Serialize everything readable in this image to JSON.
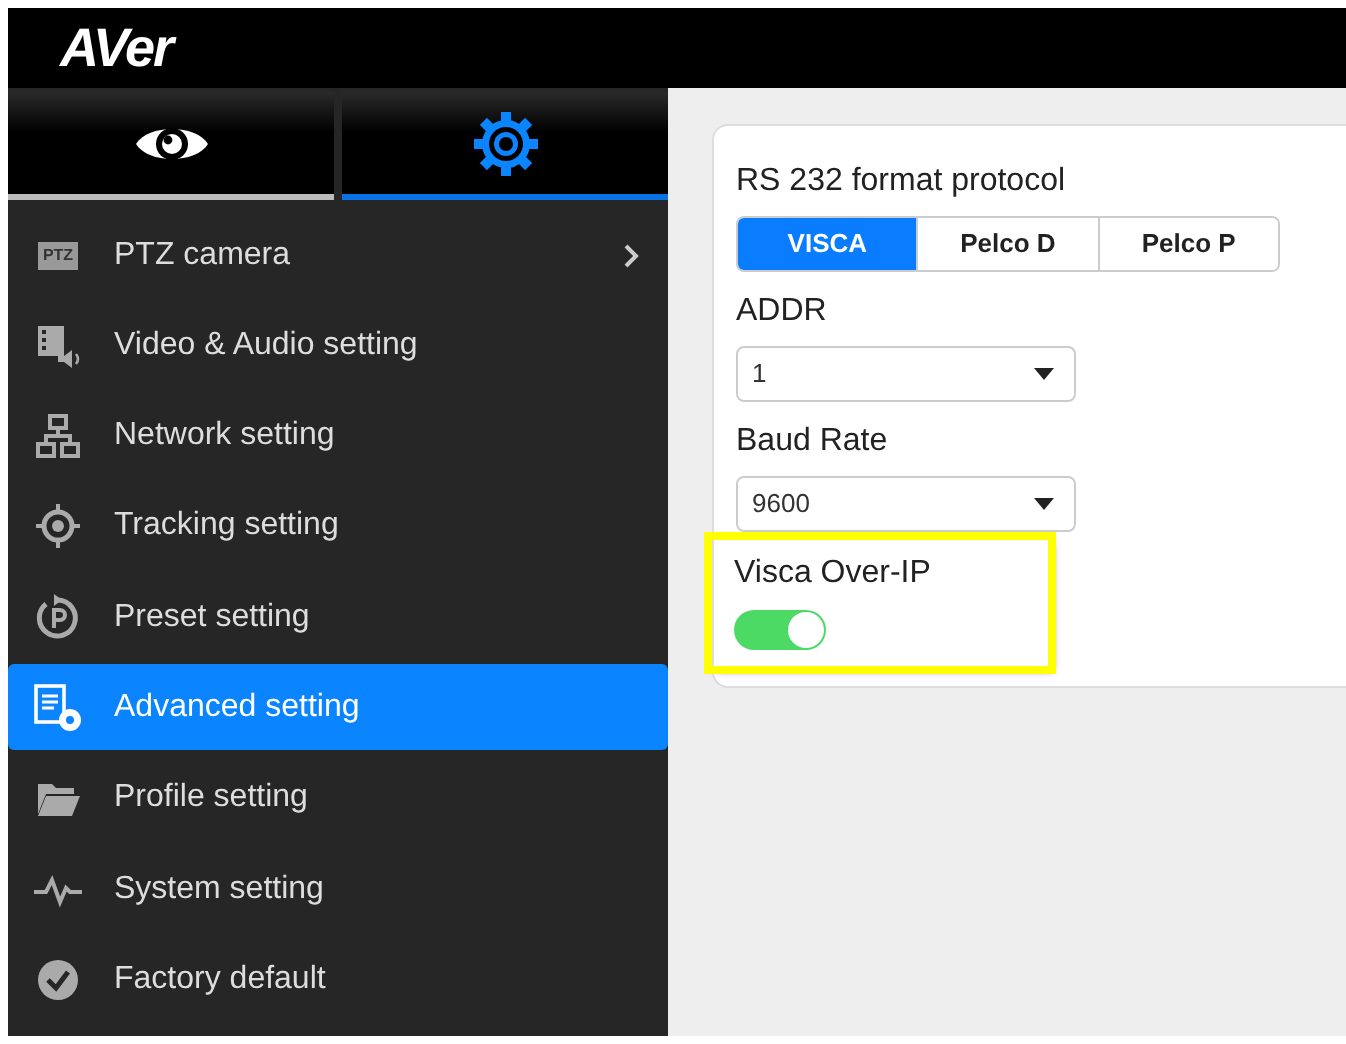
{
  "header": {
    "logo": "AVer"
  },
  "view_tabs": [
    {
      "kind": "eye",
      "selected": false
    },
    {
      "kind": "gear",
      "selected": true
    }
  ],
  "sidebar": {
    "items": [
      {
        "kind": "ptz",
        "icon_text": "PTZ",
        "label": "PTZ camera",
        "expandable": true,
        "selected": false
      },
      {
        "kind": "video",
        "label": "Video & Audio setting",
        "selected": false
      },
      {
        "kind": "network",
        "label": "Network setting",
        "selected": false
      },
      {
        "kind": "tracking",
        "label": "Tracking setting",
        "selected": false
      },
      {
        "kind": "preset",
        "label": "Preset setting",
        "selected": false
      },
      {
        "kind": "advanced",
        "label": "Advanced setting",
        "selected": true
      },
      {
        "kind": "profile",
        "label": "Profile setting",
        "selected": false
      },
      {
        "kind": "system",
        "label": "System setting",
        "selected": false
      },
      {
        "kind": "factory",
        "label": "Factory default",
        "selected": false
      }
    ]
  },
  "panel": {
    "protocol": {
      "label": "RS 232 format protocol",
      "options": [
        {
          "label": "VISCA",
          "selected": true
        },
        {
          "label": "Pelco D",
          "selected": false
        },
        {
          "label": "Pelco P",
          "selected": false
        }
      ]
    },
    "selects": [
      {
        "label": "ADDR",
        "value": "1"
      },
      {
        "label": "Baud Rate",
        "value": "9600"
      }
    ],
    "toggle": {
      "label": "Visca Over-IP",
      "on": true,
      "highlighted": true
    }
  }
}
